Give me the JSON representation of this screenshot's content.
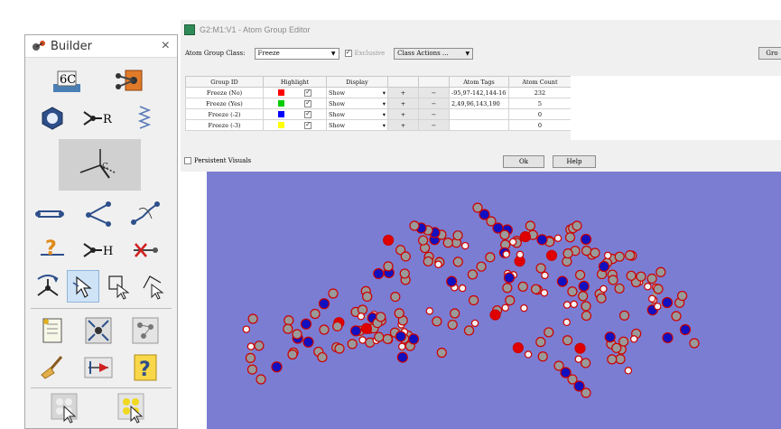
{
  "builder": {
    "title": "Builder",
    "close_glyph": "×",
    "element_label": "6C",
    "r_label": "R",
    "h_label": "H",
    "question_glyph": "?"
  },
  "editor": {
    "window_title": "G2:M1:V1 - Atom Group Editor",
    "class_label": "Atom Group Class:",
    "class_value": "Freeze",
    "exclusive_label": "Exclusive",
    "class_actions_label": "Class Actions ...",
    "right_cut_button": "Gro",
    "columns": [
      "Group ID",
      "Highlight",
      "Display",
      "",
      "",
      "Atom Tags",
      "Atom Count"
    ],
    "rows": [
      {
        "group_id": "Freeze (No)",
        "color": "#ff0000",
        "display": "Show",
        "tags": "-95,97-142,144-16",
        "count": "232"
      },
      {
        "group_id": "Freeze (Yes)",
        "color": "#00cc00",
        "display": "Show",
        "tags": "2,49,96,143,190",
        "count": "5"
      },
      {
        "group_id": "Freeze (-2)",
        "color": "#0000ff",
        "display": "Show",
        "tags": "",
        "count": "0"
      },
      {
        "group_id": "Freeze (-3)",
        "color": "#ffff00",
        "display": "Show",
        "tags": "",
        "count": "0"
      }
    ],
    "plus_glyph": "+",
    "minus_glyph": "−",
    "persistent_label": "Persistent Visuals",
    "ok_label": "Ok",
    "help_label": "Help"
  },
  "colors": {
    "view_bg": "#7b7dd3",
    "carbon": "#9a9a9a",
    "hydrogen": "#f2f2f2",
    "nitrogen": "#1010c0",
    "oxygen": "#e00000",
    "highlight_ring": "#cc0000"
  },
  "icons": [
    "builder-logo-icon",
    "close-icon",
    "element-carbon-icon",
    "fragment-cube-icon",
    "ring-icon",
    "r-group-icon",
    "chain-icon",
    "bond-icon",
    "angle-icon",
    "dihedral-icon",
    "inquire-icon",
    "add-hydrogen-icon",
    "delete-atom-icon",
    "rotate-icon",
    "select-arrow-icon",
    "select-box-icon",
    "select-lasso-icon",
    "atom-list-icon",
    "symmetrize-icon",
    "clean-connections-icon",
    "clean-broom-icon",
    "redistribute-icon",
    "help-icon",
    "select-all-icon",
    "select-group-icon"
  ]
}
